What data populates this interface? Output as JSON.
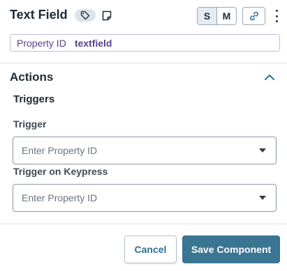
{
  "header": {
    "title": "Text Field",
    "size_options": [
      "S",
      "M"
    ],
    "active_size": "S"
  },
  "property": {
    "label": "Property ID",
    "value": "textfield"
  },
  "actions": {
    "title": "Actions",
    "triggers_title": "Triggers",
    "fields": [
      {
        "label": "Trigger",
        "placeholder": "Enter Property ID"
      },
      {
        "label": "Trigger on Keypress",
        "placeholder": "Enter Property ID"
      }
    ]
  },
  "footer": {
    "cancel_label": "Cancel",
    "save_label": "Save Component"
  },
  "colors": {
    "accent": "#3a7591",
    "property_text": "#5a3f8c",
    "title_text": "#1e2a33"
  },
  "icons": [
    "tag-icon",
    "note-icon",
    "link-icon",
    "more-vertical-icon",
    "chevron-up-icon",
    "caret-down-icon"
  ]
}
